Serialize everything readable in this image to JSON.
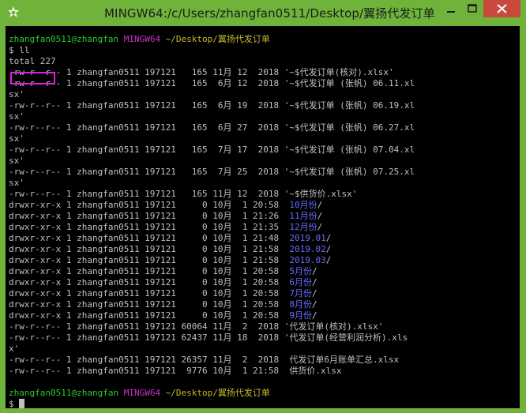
{
  "window": {
    "title": "MINGW64:/c/Users/zhangfan0511/Desktop/翼扬代发订单",
    "minimize_icon": "minimize-icon",
    "maximize_icon": "maximize-icon",
    "close_icon": "close-icon",
    "app_icon": "mingw-icon"
  },
  "colors": {
    "titlebar": "#6fb33b",
    "close": "#c94a3d",
    "prompt_user": "#2ec934",
    "prompt_host": "#c733c7",
    "prompt_path": "#c8b82c",
    "dir": "#6a6aff",
    "text": "#c0c0c0",
    "highlight": "#e020e0"
  },
  "prompt1": {
    "user": "zhangfan0511@zhangfan",
    "host": "MINGW64",
    "path": "~/Desktop/翼扬代发订单"
  },
  "command": "$ ll",
  "total": "total 227",
  "lines": [
    {
      "meta": "-rw-r--r-- 1 zhangfan0511 197121   165 11月 12  2018 ",
      "name": "'~$代发订单(核对).xlsx'",
      "dir": false
    },
    {
      "meta": "-rw-r--r-- 1 zhangfan0511 197121   165  6月 12  2018 ",
      "name": "'~$代发订单 (张帆) 06.11.xl",
      "dir": false
    },
    {
      "meta": "",
      "name": "sx'",
      "dir": false
    },
    {
      "meta": "-rw-r--r-- 1 zhangfan0511 197121   165  6月 19  2018 ",
      "name": "'~$代发订单 (张帆) 06.19.xl",
      "dir": false
    },
    {
      "meta": "",
      "name": "sx'",
      "dir": false
    },
    {
      "meta": "-rw-r--r-- 1 zhangfan0511 197121   165  6月 27  2018 ",
      "name": "'~$代发订单 (张帆) 06.27.xl",
      "dir": false
    },
    {
      "meta": "",
      "name": "sx'",
      "dir": false
    },
    {
      "meta": "-rw-r--r-- 1 zhangfan0511 197121   165  7月 17  2018 ",
      "name": "'~$代发订单 (张帆) 07.04.xl",
      "dir": false
    },
    {
      "meta": "",
      "name": "sx'",
      "dir": false
    },
    {
      "meta": "-rw-r--r-- 1 zhangfan0511 197121   165  7月 25  2018 ",
      "name": "'~$代发订单 (张帆) 07.25.xl",
      "dir": false
    },
    {
      "meta": "",
      "name": "sx'",
      "dir": false
    },
    {
      "meta": "-rw-r--r-- 1 zhangfan0511 197121   165 11月 12  2018 ",
      "name": "'~$供货价.xlsx'",
      "dir": false
    },
    {
      "meta": "drwxr-xr-x 1 zhangfan0511 197121     0 10月  1 20:58  ",
      "name": "10月份",
      "dir": true
    },
    {
      "meta": "drwxr-xr-x 1 zhangfan0511 197121     0 10月  1 21:26  ",
      "name": "11月份",
      "dir": true
    },
    {
      "meta": "drwxr-xr-x 1 zhangfan0511 197121     0 10月  1 21:35  ",
      "name": "12月份",
      "dir": true
    },
    {
      "meta": "drwxr-xr-x 1 zhangfan0511 197121     0 10月  1 21:48  ",
      "name": "2019.01",
      "dir": true
    },
    {
      "meta": "drwxr-xr-x 1 zhangfan0511 197121     0 10月  1 21:58  ",
      "name": "2019.02",
      "dir": true
    },
    {
      "meta": "drwxr-xr-x 1 zhangfan0511 197121     0 10月  1 21:58  ",
      "name": "2019.03",
      "dir": true
    },
    {
      "meta": "drwxr-xr-x 1 zhangfan0511 197121     0 10月  1 20:58  ",
      "name": "5月份",
      "dir": true
    },
    {
      "meta": "drwxr-xr-x 1 zhangfan0511 197121     0 10月  1 20:58  ",
      "name": "6月份",
      "dir": true
    },
    {
      "meta": "drwxr-xr-x 1 zhangfan0511 197121     0 10月  1 20:58  ",
      "name": "7月份",
      "dir": true
    },
    {
      "meta": "drwxr-xr-x 1 zhangfan0511 197121     0 10月  1 20:58  ",
      "name": "8月份",
      "dir": true
    },
    {
      "meta": "drwxr-xr-x 1 zhangfan0511 197121     0 10月  1 20:58  ",
      "name": "9月份",
      "dir": true
    },
    {
      "meta": "-rw-r--r-- 1 zhangfan0511 197121 60064 11月  2  2018 ",
      "name": "'代发订单(核对).xlsx'",
      "dir": false
    },
    {
      "meta": "-rw-r--r-- 1 zhangfan0511 197121 62437 11月 18  2018 ",
      "name": "'代发订单(经营利润分析).xls",
      "dir": false
    },
    {
      "meta": "",
      "name": "x'",
      "dir": false
    },
    {
      "meta": "-rw-r--r-- 1 zhangfan0511 197121 26357 11月  2  2018  ",
      "name": "代发订单6月账单汇总.xlsx",
      "dir": false
    },
    {
      "meta": "-rw-r--r-- 1 zhangfan0511 197121  9776 10月  1 21:58  ",
      "name": "供货价.xlsx",
      "dir": false
    }
  ],
  "prompt2": {
    "user": "zhangfan0511@zhangfan",
    "host": "MINGW64",
    "path": "~/Desktop/翼扬代发订单"
  },
  "final_prompt": "$"
}
